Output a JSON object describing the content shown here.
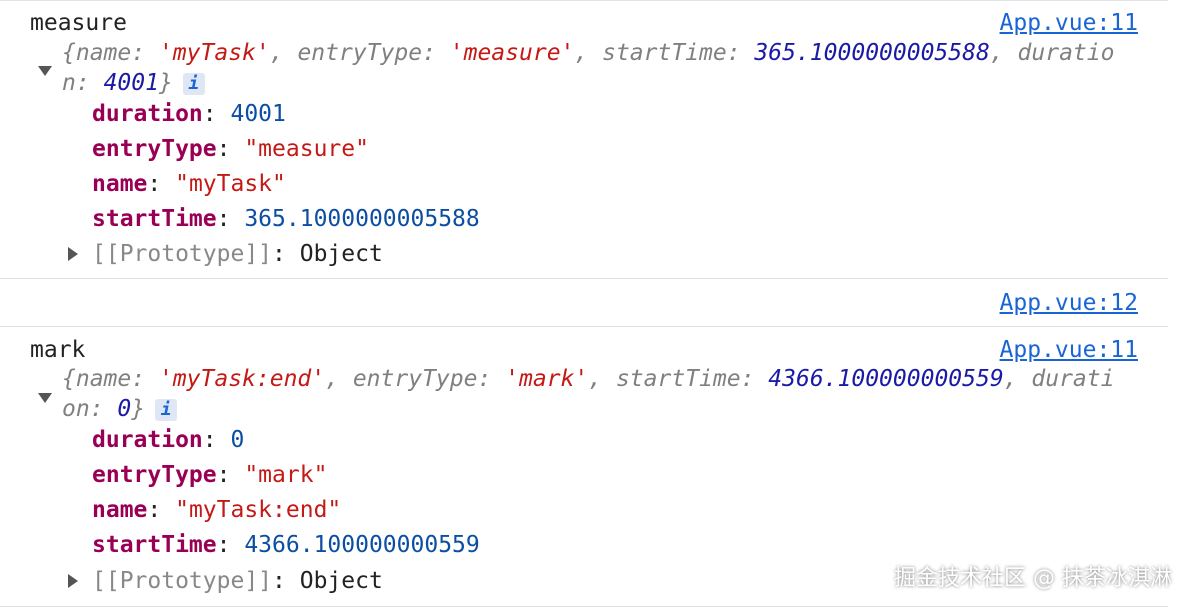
{
  "msg1": {
    "label": "measure",
    "source": "App.vue:11",
    "preview": {
      "open": "{",
      "k1": "name",
      "v1": "'myTask'",
      "k2": "entryType",
      "v2": "'measure'",
      "k3": "startTime",
      "v3": "365.1000000005588",
      "k4a": "duratio",
      "k4b": "n",
      "v4": "4001",
      "close": "}",
      "info": "i"
    },
    "props": [
      {
        "key": "duration",
        "value": "4001"
      },
      {
        "key": "entryType",
        "value": "\"measure\""
      },
      {
        "key": "name",
        "value": "\"myTask\""
      },
      {
        "key": "startTime",
        "value": "365.1000000005588"
      }
    ],
    "prototype": "[[Prototype]]",
    "prototype_value": "Object"
  },
  "msg2": {
    "source": "App.vue:12"
  },
  "msg3": {
    "label": "mark",
    "source": "App.vue:11",
    "preview": {
      "open": "{",
      "k1": "name",
      "v1": "'myTask:end'",
      "k2": "entryType",
      "v2": "'mark'",
      "k3": "startTime",
      "v3": "4366.100000000559",
      "k4a": "durati",
      "k4b": "on",
      "v4": "0",
      "close": "}",
      "info": "i"
    },
    "props": [
      {
        "key": "duration",
        "value": "0"
      },
      {
        "key": "entryType",
        "value": "\"mark\""
      },
      {
        "key": "name",
        "value": "\"myTask:end\""
      },
      {
        "key": "startTime",
        "value": "4366.100000000559"
      }
    ],
    "prototype": "[[Prototype]]",
    "prototype_value": "Object"
  },
  "watermark": "掘金技术社区 @ 抹茶冰淇淋"
}
